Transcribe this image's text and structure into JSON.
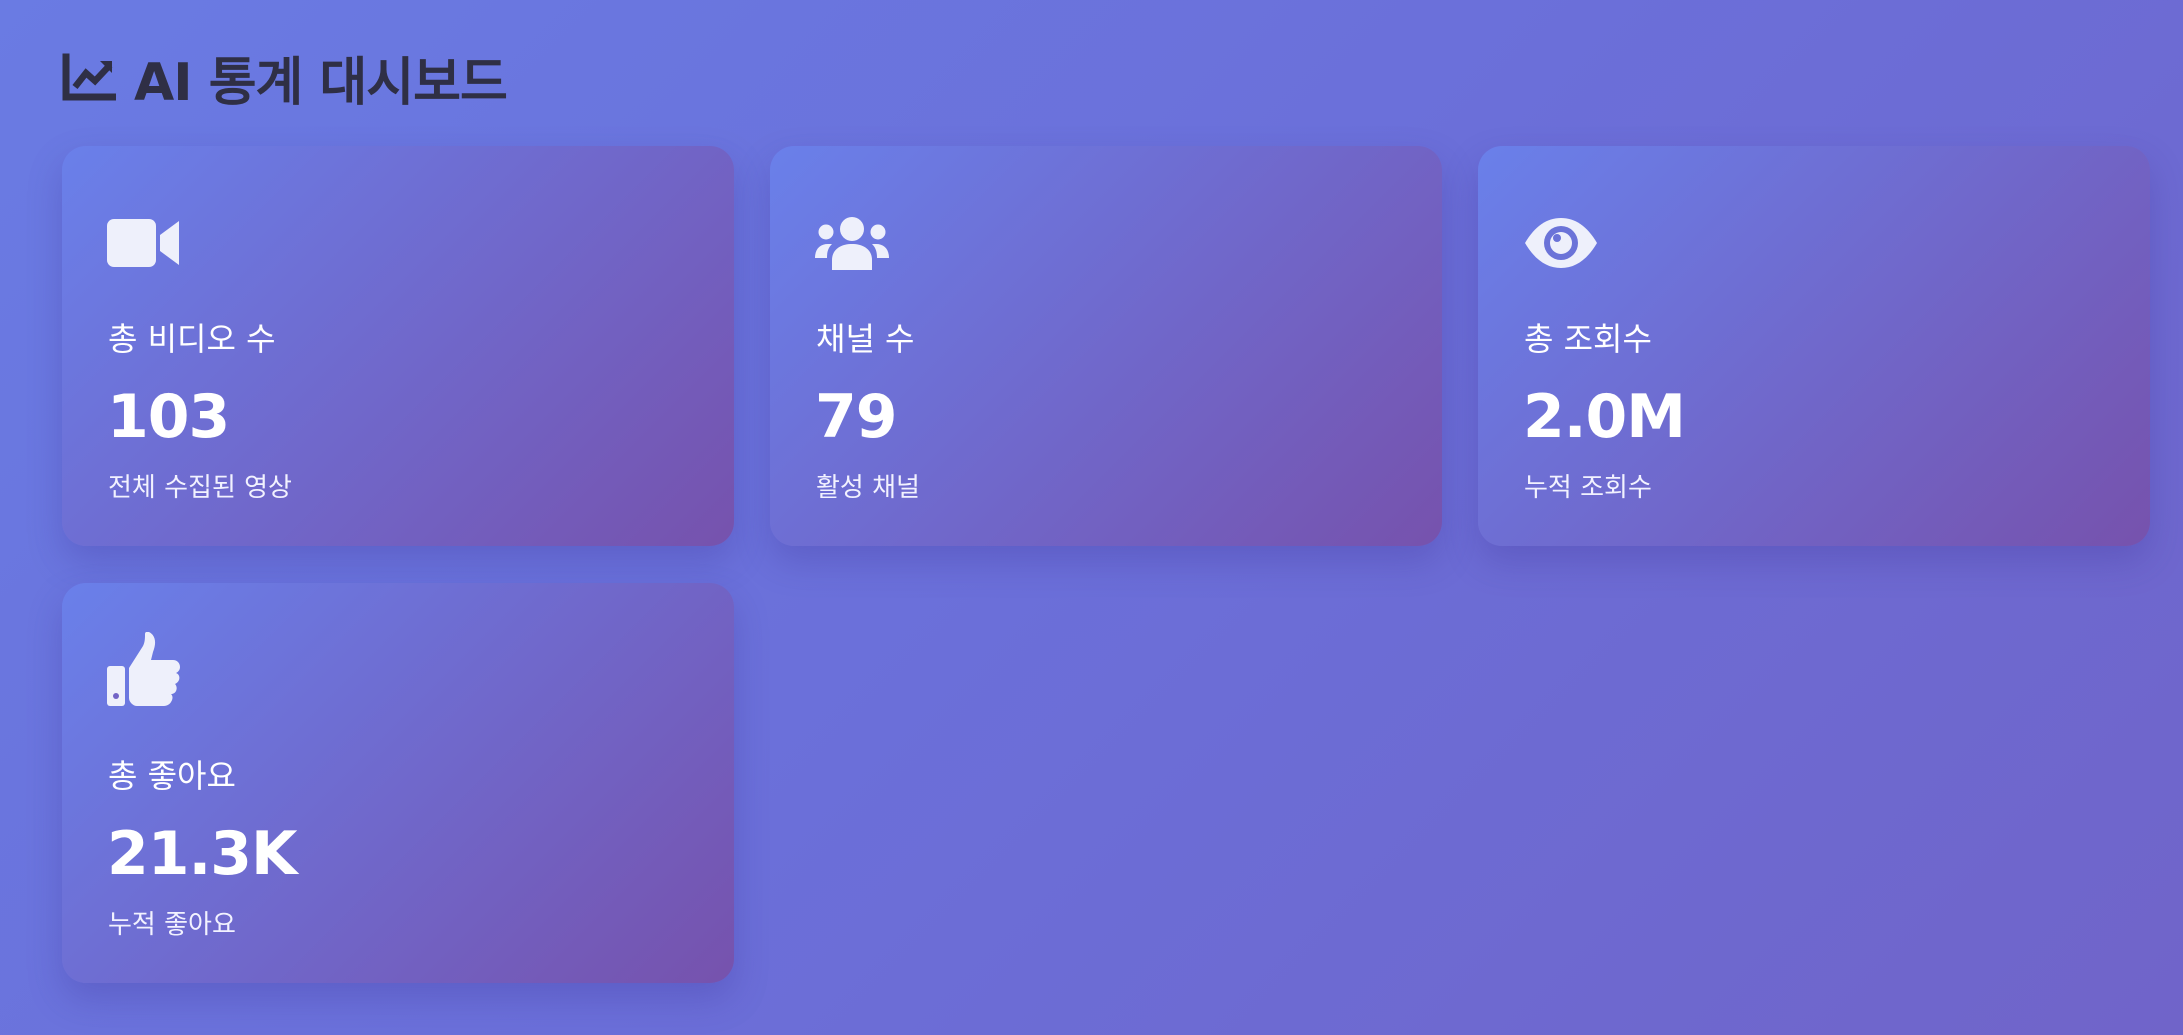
{
  "header": {
    "title": "AI 통계 대시보드",
    "icon": "chart-line-icon"
  },
  "cards": [
    {
      "icon": "video-camera-icon",
      "label": "총 비디오 수",
      "value": "103",
      "subtitle": "전체 수집된 영상"
    },
    {
      "icon": "users-icon",
      "label": "채널 수",
      "value": "79",
      "subtitle": "활성 채널"
    },
    {
      "icon": "eye-icon",
      "label": "총 조회수",
      "value": "2.0M",
      "subtitle": "누적 조회수"
    },
    {
      "icon": "thumbs-up-icon",
      "label": "총 좋아요",
      "value": "21.3K",
      "subtitle": "누적 좋아요"
    }
  ]
}
